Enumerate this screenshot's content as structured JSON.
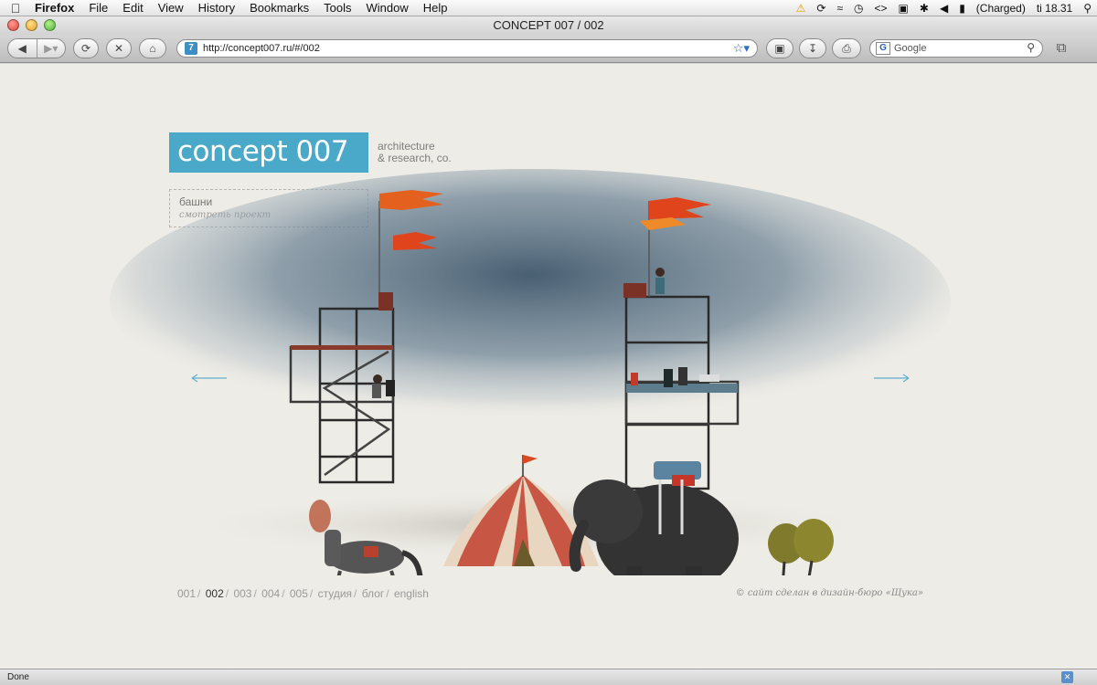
{
  "menubar": {
    "app": "Firefox",
    "items": [
      "File",
      "Edit",
      "View",
      "History",
      "Bookmarks",
      "Tools",
      "Window",
      "Help"
    ],
    "battery": "(Charged)",
    "clock": "ti 18.31"
  },
  "window": {
    "title": "CONCEPT 007 / 002"
  },
  "toolbar": {
    "url": "http://concept007.ru/#/002",
    "search_placeholder": "Google"
  },
  "site": {
    "logo_text": "concept 007",
    "tagline_line1": "architecture",
    "tagline_line2": "& research, co.",
    "project_title": "башни",
    "project_link": "смотреть проект",
    "nav": [
      {
        "label": "001",
        "active": false
      },
      {
        "label": "002",
        "active": true
      },
      {
        "label": "003",
        "active": false
      },
      {
        "label": "004",
        "active": false
      },
      {
        "label": "005",
        "active": false
      },
      {
        "label": "студия",
        "active": false
      },
      {
        "label": "блог",
        "active": false
      },
      {
        "label": "english",
        "active": false
      }
    ],
    "copyright": "© сайт сделан в дизайн-бюро «Щука»",
    "accent_color": "#4aa8c8"
  },
  "status": {
    "text": "Done"
  }
}
